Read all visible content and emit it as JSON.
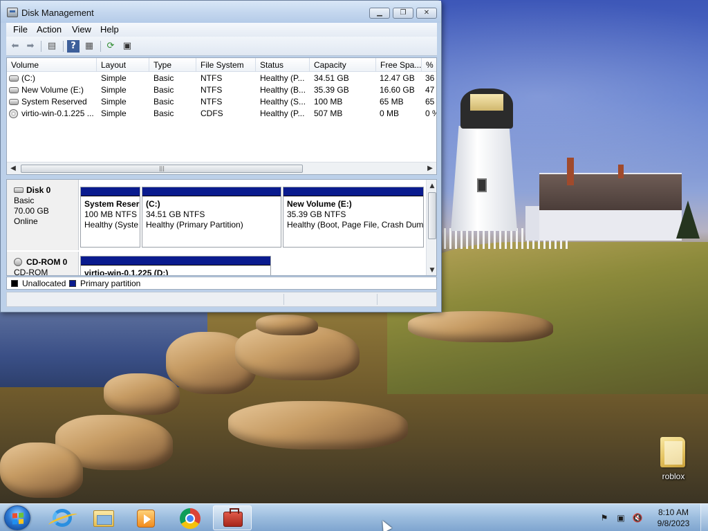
{
  "window": {
    "title": "Disk Management",
    "menu": [
      "File",
      "Action",
      "View",
      "Help"
    ],
    "toolbar_icons": [
      "back-icon",
      "forward-icon",
      "show-hide-console-tree-icon",
      "help-icon",
      "properties-icon",
      "refresh-icon",
      "disk-settings-icon"
    ],
    "volume_list": {
      "columns": [
        "Volume",
        "Layout",
        "Type",
        "File System",
        "Status",
        "Capacity",
        "Free Spa...",
        "% F"
      ],
      "rows": [
        {
          "icon": "volume-icon",
          "cells": [
            " (C:)",
            "Simple",
            "Basic",
            "NTFS",
            "Healthy (P...",
            "34.51 GB",
            "12.47 GB",
            "36"
          ]
        },
        {
          "icon": "volume-icon",
          "cells": [
            "New Volume (E:)",
            "Simple",
            "Basic",
            "NTFS",
            "Healthy (B...",
            "35.39 GB",
            "16.60 GB",
            "47"
          ]
        },
        {
          "icon": "volume-icon",
          "cells": [
            "System Reserved",
            "Simple",
            "Basic",
            "NTFS",
            "Healthy (S...",
            "100 MB",
            "65 MB",
            "65"
          ]
        },
        {
          "icon": "cdrom-icon",
          "cells": [
            "virtio-win-0.1.225 ...",
            "Simple",
            "Basic",
            "CDFS",
            "Healthy (P...",
            "507 MB",
            "0 MB",
            "0 %"
          ]
        }
      ]
    },
    "disks": [
      {
        "name": "Disk 0",
        "lines": [
          "Basic",
          "70.00 GB",
          "Online"
        ],
        "partitions": [
          {
            "name": "System Reser",
            "size": "100 MB NTFS",
            "status": "Healthy (Syste"
          },
          {
            "name": " (C:)",
            "size": "34.51 GB NTFS",
            "status": "Healthy (Primary Partition)"
          },
          {
            "name": "New Volume  (E:)",
            "size": "35.39 GB NTFS",
            "status": "Healthy (Boot, Page File, Crash Dum"
          }
        ]
      },
      {
        "name": "CD-ROM 0",
        "lines": [
          "CD-ROM"
        ],
        "partitions": [
          {
            "name": "virtio-win-0.1.225  (D:)",
            "size": "",
            "status": ""
          }
        ]
      }
    ],
    "legend": [
      {
        "label": "Unallocated",
        "color": "#000000"
      },
      {
        "label": "Primary partition",
        "color": "#0a1b8e"
      }
    ]
  },
  "desktop": {
    "icons": [
      {
        "label": "roblox",
        "icon": "folder-icon"
      }
    ]
  },
  "taskbar": {
    "apps": [
      "internet-explorer-icon",
      "windows-explorer-icon",
      "media-player-icon",
      "chrome-icon",
      "disk-management-icon"
    ],
    "tray": [
      "action-center-flag-icon",
      "network-icon",
      "volume-muted-icon"
    ],
    "time": "8:10 AM",
    "date": "9/8/2023"
  }
}
